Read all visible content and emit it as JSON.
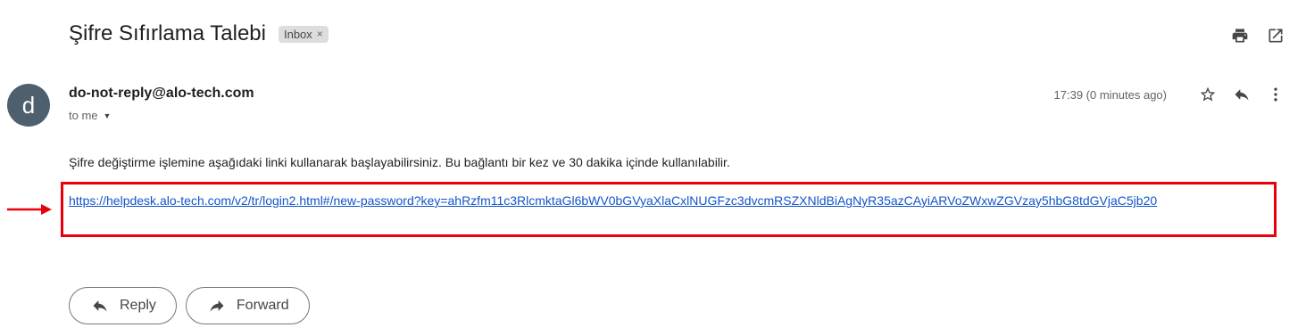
{
  "email": {
    "subject": "Şifre Sıfırlama Talebi",
    "label": "Inbox",
    "label_remove": "×",
    "sender_initial": "d",
    "sender": "do-not-reply@alo-tech.com",
    "recipients": "to me",
    "time": "17:39 (0 minutes ago)",
    "body_text": "Şifre değiştirme işlemine aşağıdaki linki kullanarak başlayabilirsiniz. Bu bağlantı bir kez ve 30 dakika içinde kullanılabilir.",
    "link": "https://helpdesk.alo-tech.com/v2/tr/login2.html#/new-password?key=ahRzfm11c3RlcmktaGl6bWV0bGVyaXlaCxlNUGFzc3dvcmRSZXNldBiAgNyR35azCAyiARVoZWxwZGVzay5hbG8tdGVjaC5jb20"
  },
  "actions": {
    "reply": "Reply",
    "forward": "Forward"
  },
  "icons": {
    "print": "print-icon",
    "open_new_window": "open-in-new-window-icon",
    "star": "star-icon",
    "reply": "reply-icon",
    "more": "more-vert-icon",
    "forward": "forward-icon"
  },
  "colors": {
    "highlight_box": "#e8000b",
    "link": "#1155cc",
    "avatar": "#4e5f6e"
  }
}
